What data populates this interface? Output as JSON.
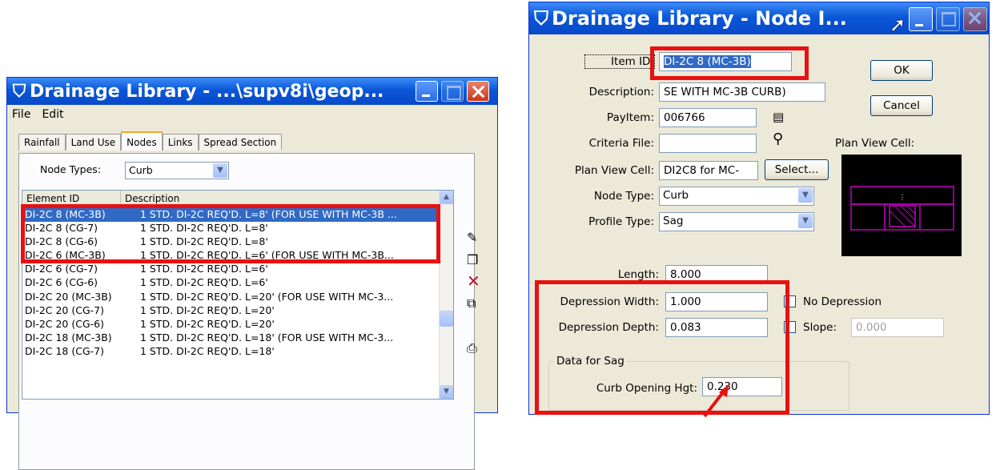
{
  "left_window": {
    "title": "Drainage Library - ...\\supv8i\\geop...",
    "menu": [
      "File",
      "Edit"
    ],
    "tabs": [
      "Rainfall",
      "Land Use",
      "Nodes",
      "Links",
      "Spread Section"
    ],
    "active_tab": "Nodes",
    "node_types_label": "Node Types:",
    "node_types_value": "Curb",
    "columns": [
      "Element ID",
      "Description"
    ],
    "rows": [
      {
        "id": "DI-2C 8 (MC-3B)",
        "desc": "1 STD. DI-2C REQ'D. L=8' (FOR USE WITH MC-3B ...",
        "selected": true
      },
      {
        "id": "DI-2C 8 (CG-7)",
        "desc": "1 STD. DI-2C REQ'D. L=8'"
      },
      {
        "id": "DI-2C 8 (CG-6)",
        "desc": "1 STD. DI-2C REQ'D. L=8'"
      },
      {
        "id": "DI-2C 6 (MC-3B)",
        "desc": "1 STD. DI-2C REQ'D. L=6' (FOR USE WITH MC-3B..."
      },
      {
        "id": "DI-2C 6 (CG-7)",
        "desc": "1 STD. DI-2C REQ'D. L=6'"
      },
      {
        "id": "DI-2C 6 (CG-6)",
        "desc": "1 STD. DI-2C REQ'D. L=6'"
      },
      {
        "id": "DI-2C 20 (MC-3B)",
        "desc": "1 STD. DI-2C REQ'D. L=20' (FOR USE WITH MC-3..."
      },
      {
        "id": "DI-2C 20 (CG-7)",
        "desc": "1 STD. DI-2C REQ'D. L=20'"
      },
      {
        "id": "DI-2C 20 (CG-6)",
        "desc": "1 STD. DI-2C REQ'D. L=20'"
      },
      {
        "id": "DI-2C 18 (MC-3B)",
        "desc": "1 STD. DI-2C REQ'D. L=18' (FOR USE WITH MC-3..."
      },
      {
        "id": "DI-2C 18 (CG-7)",
        "desc": "1 STD. DI-2C REQ'D. L=18'"
      }
    ]
  },
  "right_window": {
    "title": "Drainage Library - Node I...",
    "item_id_label": "Item ID:",
    "item_id_value": "DI-2C 8 (MC-3B)",
    "description_label": "Description:",
    "description_value": "SE WITH MC-3B CURB)",
    "payitem_label": "PayItem:",
    "payitem_value": "006766",
    "criteria_label": "Criteria File:",
    "criteria_value": "",
    "plan_view_cell_label": "Plan View Cell:",
    "plan_view_cell_value": "DI2C8 for MC-",
    "select_button": "Select...",
    "plan_view_cell_caption": "Plan View Cell:",
    "node_type_label": "Node Type:",
    "node_type_value": "Curb",
    "profile_type_label": "Profile Type:",
    "profile_type_value": "Sag",
    "length_label": "Length:",
    "length_value": "8.000",
    "dep_width_label": "Depression Width:",
    "dep_width_value": "1.000",
    "dep_depth_label": "Depression Depth:",
    "dep_depth_value": "0.083",
    "no_depression_label": "No Depression",
    "slope_label": "Slope:",
    "slope_value": "0.000",
    "group_title": "Data for Sag",
    "curb_opening_label": "Curb Opening Hgt:",
    "curb_opening_value": "0.230",
    "ok_button": "OK",
    "cancel_button": "Cancel"
  },
  "colors": {
    "annotation": "#e81010",
    "selection": "#316ac5",
    "cell_lines": "#c000c0"
  }
}
